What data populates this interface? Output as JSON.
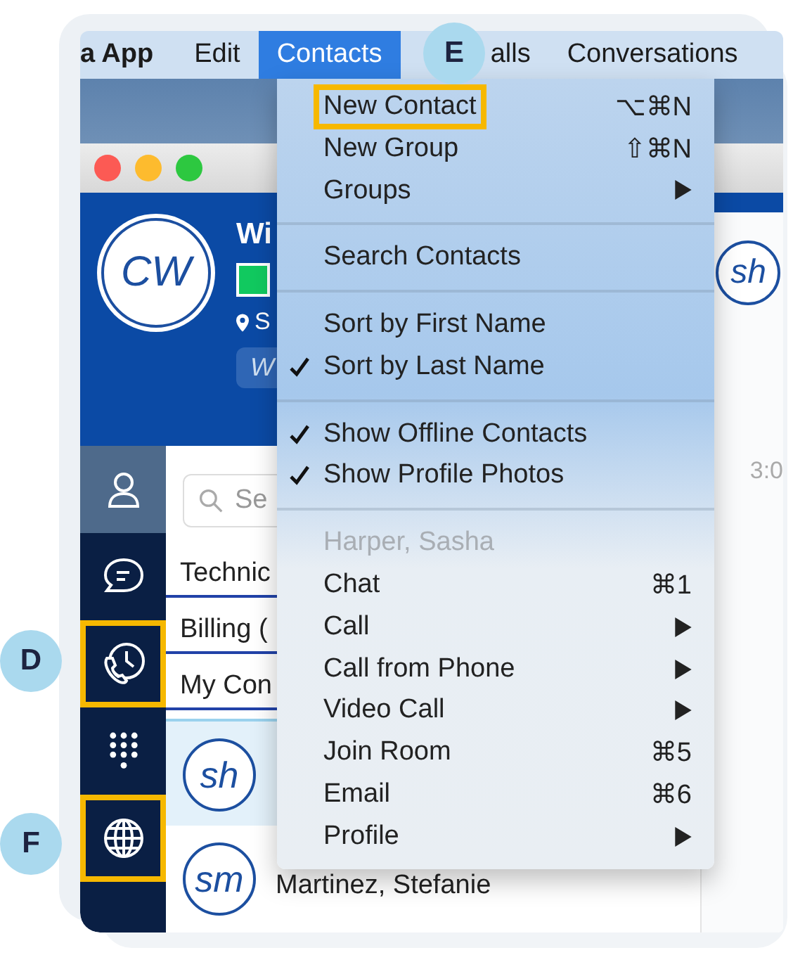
{
  "menu_bar": {
    "items": [
      {
        "label": "a App",
        "selected": false
      },
      {
        "label": "Edit",
        "selected": false
      },
      {
        "label": "Contacts",
        "selected": true
      },
      {
        "label": "alls",
        "selected": false
      },
      {
        "label": "Conversations",
        "selected": false
      }
    ]
  },
  "profile": {
    "initials": "CW",
    "name": "Wi",
    "location": "S",
    "status_chip": "W"
  },
  "sidebar": {
    "items": [
      {
        "kind": "contacts",
        "selected": true,
        "highlighted": false
      },
      {
        "kind": "chat",
        "selected": false,
        "highlighted": false
      },
      {
        "kind": "history",
        "selected": false,
        "highlighted": true
      },
      {
        "kind": "dialpad",
        "selected": false,
        "highlighted": false
      },
      {
        "kind": "globe",
        "selected": false,
        "highlighted": true
      }
    ]
  },
  "contact_list": {
    "search_placeholder": "Se",
    "groups": [
      {
        "label": "Technic"
      },
      {
        "label": "Billing ("
      },
      {
        "label": "My Con"
      }
    ],
    "contacts": [
      {
        "initials": "sh",
        "selected": true
      },
      {
        "initials": "sm",
        "name": "Martinez, Stefanie",
        "selected": false
      }
    ]
  },
  "conversation": {
    "avatar_initials": "sh",
    "time": "3:0"
  },
  "menu": {
    "items": [
      {
        "kind": "item",
        "label": "New Contact",
        "shortcut": "⌥⌘N",
        "checked": false,
        "submenu": false,
        "highlighted": true
      },
      {
        "kind": "item",
        "label": "New Group",
        "shortcut": "⇧⌘N",
        "checked": false,
        "submenu": false,
        "highlighted": false
      },
      {
        "kind": "item",
        "label": "Groups",
        "checked": false,
        "submenu": true,
        "highlighted": false
      },
      {
        "kind": "separator"
      },
      {
        "kind": "item",
        "label": "Search Contacts",
        "checked": false,
        "submenu": false,
        "highlighted": false
      },
      {
        "kind": "separator"
      },
      {
        "kind": "item",
        "label": "Sort by First Name",
        "checked": false,
        "submenu": false,
        "highlighted": false
      },
      {
        "kind": "item",
        "label": "Sort by Last Name",
        "checked": true,
        "submenu": false,
        "highlighted": false
      },
      {
        "kind": "separator"
      },
      {
        "kind": "item",
        "label": "Show Offline Contacts",
        "checked": true,
        "submenu": false,
        "highlighted": false
      },
      {
        "kind": "item",
        "label": "Show Profile Photos",
        "checked": true,
        "submenu": false,
        "highlighted": false
      },
      {
        "kind": "separator"
      },
      {
        "kind": "header",
        "label": "Harper, Sasha"
      },
      {
        "kind": "item",
        "label": "Chat",
        "shortcut": "⌘1",
        "checked": false,
        "submenu": false,
        "highlighted": false
      },
      {
        "kind": "item",
        "label": "Call",
        "checked": false,
        "submenu": true,
        "highlighted": false
      },
      {
        "kind": "item",
        "label": "Call from Phone",
        "checked": false,
        "submenu": true,
        "highlighted": false
      },
      {
        "kind": "item",
        "label": "Video Call",
        "checked": false,
        "submenu": true,
        "highlighted": false
      },
      {
        "kind": "item",
        "label": "Join Room",
        "shortcut": "⌘5",
        "checked": false,
        "submenu": false,
        "highlighted": false
      },
      {
        "kind": "item",
        "label": "Email",
        "shortcut": "⌘6",
        "checked": false,
        "submenu": false,
        "highlighted": false
      },
      {
        "kind": "item",
        "label": "Profile",
        "checked": false,
        "submenu": true,
        "highlighted": false
      }
    ]
  },
  "callouts": [
    {
      "label": "D"
    },
    {
      "label": "E"
    },
    {
      "label": "F"
    }
  ]
}
